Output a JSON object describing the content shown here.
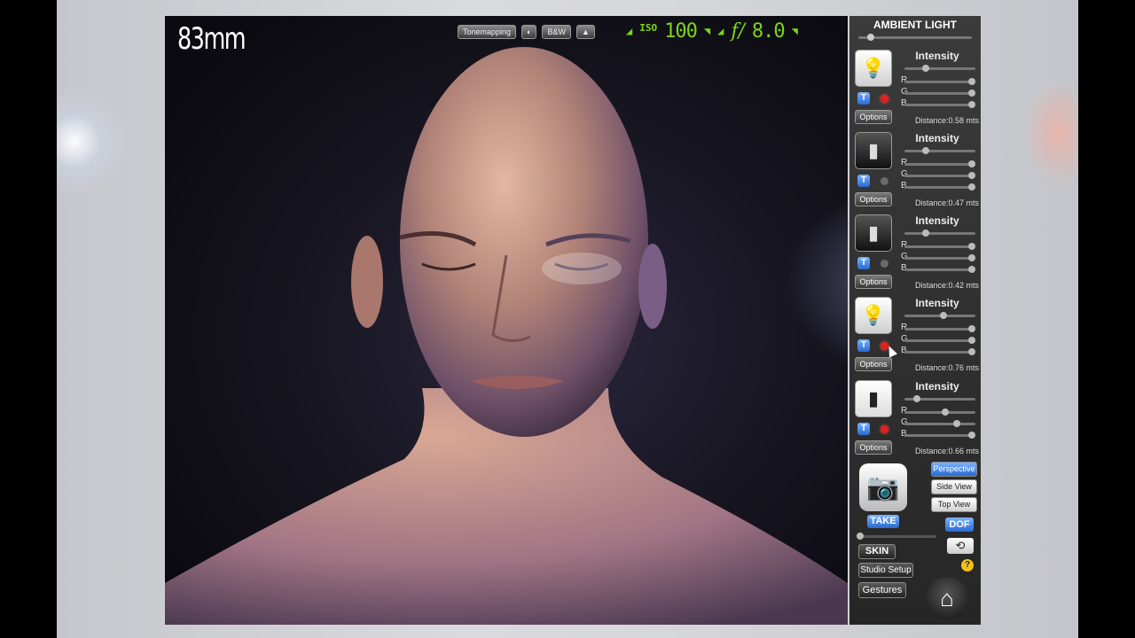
{
  "viewport": {
    "focal_length": "83mm"
  },
  "toolbar": {
    "tonemapping_label": "Tonemapping",
    "bw_label": "B&W",
    "iso_label": "ISO",
    "iso_value": "100",
    "fstop_label": "f/",
    "fstop_value": "8.0"
  },
  "panel": {
    "ambient_title": "AMBIENT LIGHT",
    "lights": [
      {
        "intensity_label": "Intensity",
        "r": "R",
        "g": "G",
        "b": "B",
        "t_label": "T",
        "options_label": "Options",
        "distance": "Distance:0.58 mts",
        "type_icon": "bulb-icon",
        "enabled": true
      },
      {
        "intensity_label": "Intensity",
        "r": "R",
        "g": "G",
        "b": "B",
        "t_label": "T",
        "options_label": "Options",
        "distance": "Distance:0.47 mts",
        "type_icon": "softbox-icon",
        "enabled": false
      },
      {
        "intensity_label": "Intensity",
        "r": "R",
        "g": "G",
        "b": "B",
        "t_label": "T",
        "options_label": "Options",
        "distance": "Distance:0.42 mts",
        "type_icon": "softbox-icon",
        "enabled": false
      },
      {
        "intensity_label": "Intensity",
        "r": "R",
        "g": "G",
        "b": "B",
        "t_label": "T",
        "options_label": "Options",
        "distance": "Distance:0.76 mts",
        "type_icon": "bulb-icon",
        "enabled": true
      },
      {
        "intensity_label": "Intensity",
        "r": "R",
        "g": "G",
        "b": "B",
        "t_label": "T",
        "options_label": "Options",
        "distance": "Distance:0.66 mts",
        "type_icon": "softbox-icon",
        "enabled": true
      }
    ],
    "perspective_label": "Perspective",
    "sideview_label": "Side View",
    "topview_label": "Top View",
    "take_label": "TAKE",
    "dof_label": "DOF",
    "skin_label": "SKIN",
    "studio_label": "Studio Setup",
    "gestures_label": "Gestures",
    "help_label": "?"
  },
  "colors": {
    "accent_blue": "#2a6ad0",
    "readout_green": "#7cd61a",
    "record_red": "#e02020"
  }
}
